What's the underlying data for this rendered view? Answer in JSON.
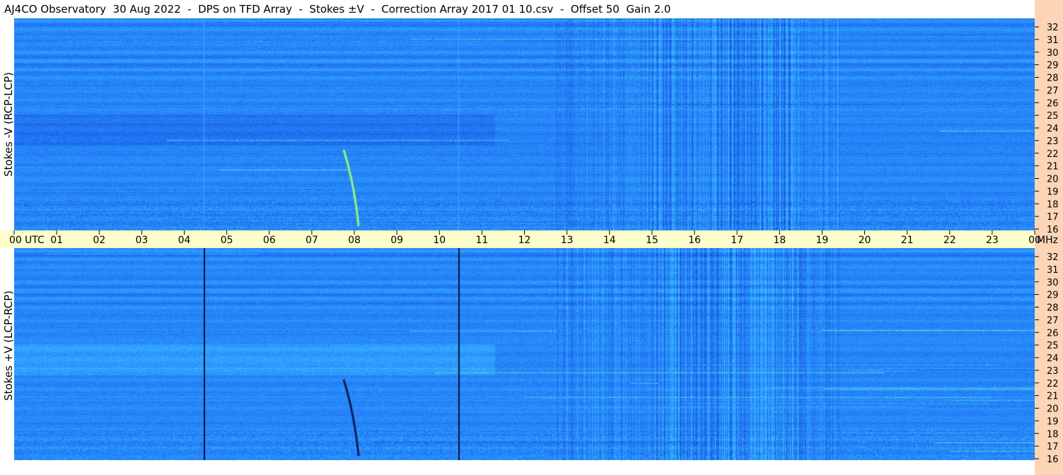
{
  "title": "AJ4CO Observatory  30 Aug 2022  -  DPS on TFD Array  -  Stokes ±V  -  Correction Array 2017 01 10.csv  -  Offset 50  Gain 2.0",
  "chart_data": {
    "type": "heatmap",
    "panels": [
      {
        "ylabel": "Stokes -V (RCP-LCP)",
        "ylim": [
          16,
          32
        ],
        "y_ticks": [
          "16",
          "17",
          "18",
          "19",
          "20",
          "21",
          "22",
          "23",
          "24",
          "25",
          "26",
          "27",
          "28",
          "29",
          "30",
          "31",
          "32"
        ],
        "y_unit": "MHz",
        "x_start_utc": "00",
        "x_end_utc": "00"
      },
      {
        "ylabel": "Stokes +V (LCP-RCP)",
        "ylim": [
          16,
          32
        ],
        "y_ticks": [
          "16",
          "17",
          "18",
          "19",
          "20",
          "21",
          "22",
          "23",
          "24",
          "25",
          "26",
          "27",
          "28",
          "29",
          "30",
          "31",
          "32"
        ],
        "y_unit": "MHz",
        "x_start_utc": "00",
        "x_end_utc": "00"
      }
    ],
    "x_ticks": [
      "00",
      "01",
      "02",
      "03",
      "04",
      "05",
      "06",
      "07",
      "08",
      "09",
      "10",
      "11",
      "12",
      "13",
      "14",
      "15",
      "16",
      "17",
      "18",
      "19",
      "20",
      "21",
      "22",
      "23",
      "00"
    ],
    "x_tick_values": [
      0,
      1,
      2,
      3,
      4,
      5,
      6,
      7,
      8,
      9,
      10,
      11,
      12,
      13,
      14,
      15,
      16,
      17,
      18,
      19,
      20,
      21,
      22,
      23,
      24
    ],
    "x_unit_label": "UTC",
    "y_unit_label": "MHz",
    "colormap": [
      "#0a1a8c",
      "#1446c8",
      "#1e6ef0",
      "#2e9cff",
      "#44d8ff",
      "#a8ff66",
      "#ffe14a",
      "#ff5a8a"
    ],
    "grid": false
  },
  "colors": {
    "axis_strip": "#ffffcc",
    "right_strip": "#fbd5b5",
    "label_text": "#000000"
  }
}
